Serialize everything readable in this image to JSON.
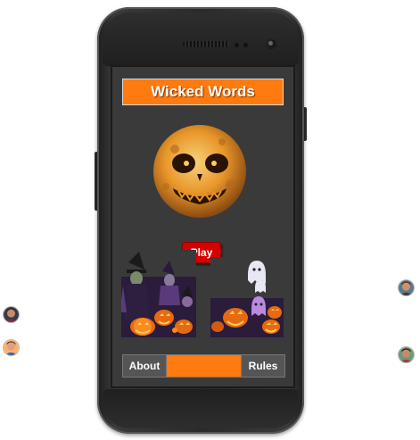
{
  "app": {
    "title": "Wicked Words"
  },
  "buttons": {
    "play": "Play",
    "about": "About",
    "rules": "Rules"
  },
  "colors": {
    "accent": "#ff7a0f",
    "play": "#d40000",
    "screen": "#3a3a3a",
    "button": "#555555"
  },
  "images": {
    "hero": "pumpkin-moon-image",
    "left_scene": "witch-and-pumpkins-image",
    "right_scene": "ghosts-and-pumpkins-image"
  },
  "avatars": [
    "player-avatar",
    "player-avatar",
    "player-avatar",
    "player-avatar"
  ]
}
